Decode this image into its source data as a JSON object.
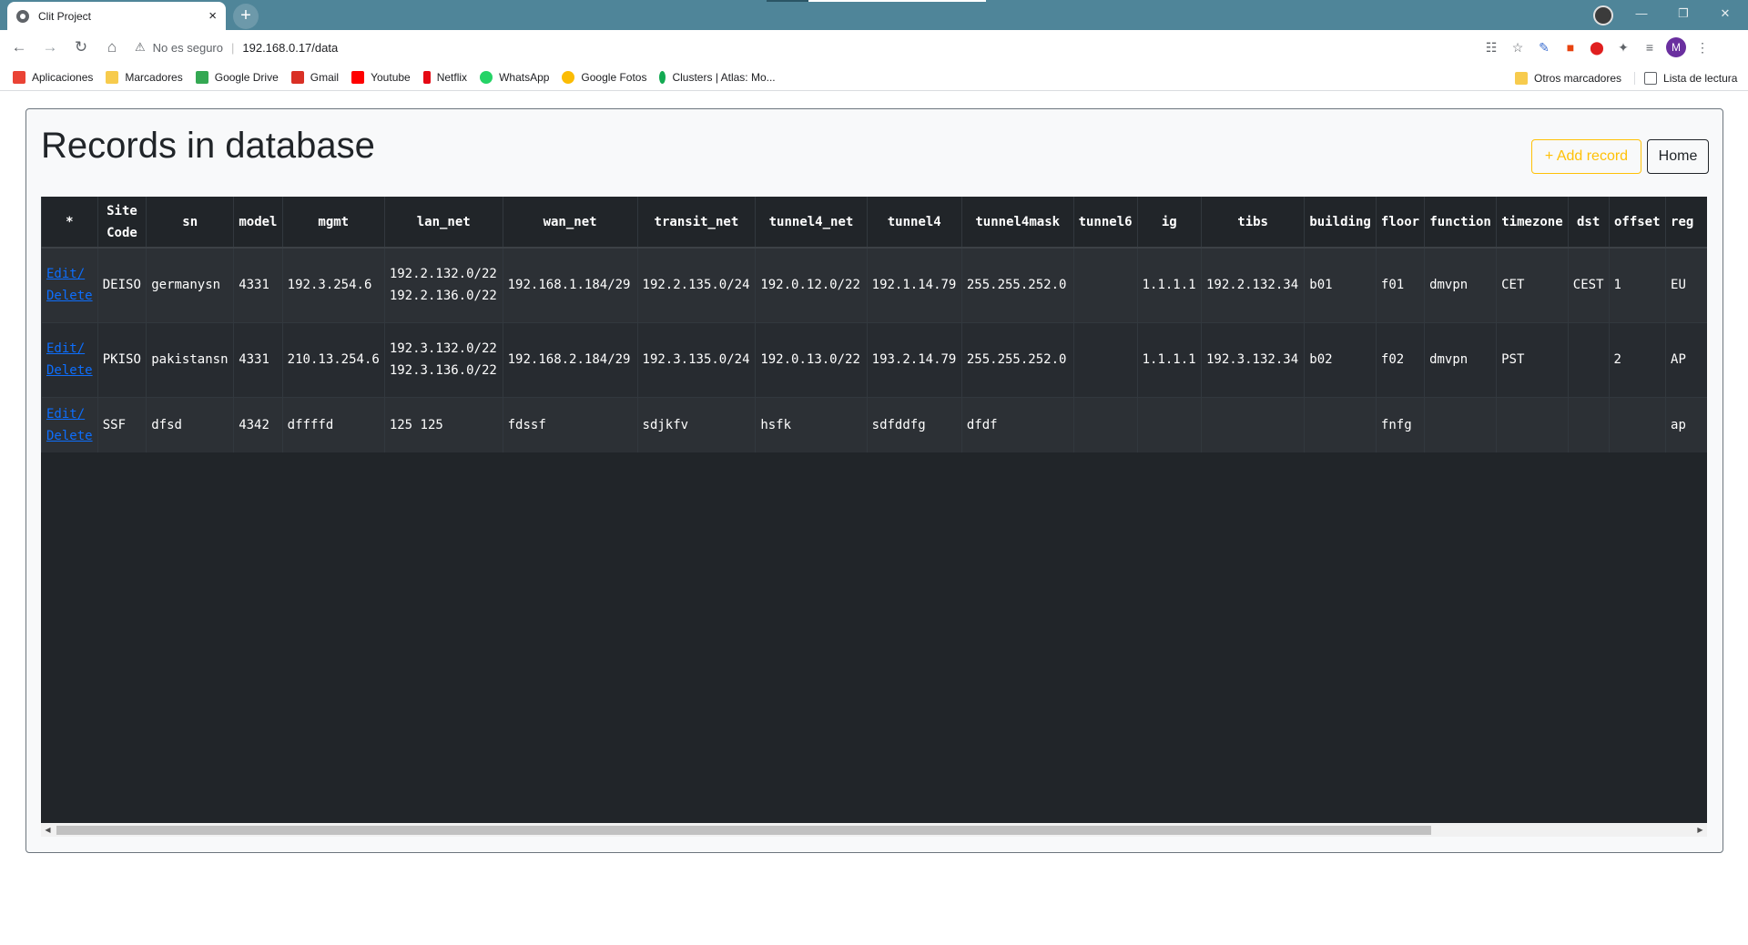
{
  "browser": {
    "tab_title": "Clit Project",
    "tab_close": "×",
    "new_tab": "+",
    "address_warning": "No es seguro",
    "url": "192.168.0.17/data",
    "bookmarks": [
      {
        "label": "Aplicaciones",
        "icon": "apps-grid-icon",
        "color": "#ea4335"
      },
      {
        "label": "Marcadores",
        "icon": "folder-icon",
        "color": "#f7cb4d"
      },
      {
        "label": "Google Drive",
        "icon": "google-drive-icon",
        "color": "#34a853"
      },
      {
        "label": "Gmail",
        "icon": "gmail-icon",
        "color": "#d93025"
      },
      {
        "label": "Youtube",
        "icon": "youtube-icon",
        "color": "#ff0000"
      },
      {
        "label": "Netflix",
        "icon": "netflix-icon",
        "color": "#e50914"
      },
      {
        "label": "WhatsApp",
        "icon": "whatsapp-icon",
        "color": "#25d366"
      },
      {
        "label": "Google Fotos",
        "icon": "google-photos-icon",
        "color": "#fbbc04"
      },
      {
        "label": "Clusters | Atlas: Mo...",
        "icon": "mongodb-leaf-icon",
        "color": "#13aa52"
      }
    ],
    "bookmarks_right": [
      {
        "label": "Otros marcadores",
        "icon": "folder-icon",
        "color": "#f7cb4d"
      },
      {
        "label": "Lista de lectura",
        "icon": "reading-list-icon",
        "color": "#5f6368"
      }
    ],
    "profile_initial": "M"
  },
  "page": {
    "title": "Records in database",
    "add_button": "+ Add record",
    "home_button": "Home"
  },
  "table": {
    "columns": [
      "*",
      "Site Code",
      "sn",
      "model",
      "mgmt",
      "lan_net",
      "wan_net",
      "transit_net",
      "tunnel4_net",
      "tunnel4",
      "tunnel4mask",
      "tunnel6",
      "ig",
      "tibs",
      "building",
      "floor",
      "function",
      "timezone",
      "dst",
      "offset",
      "reg"
    ],
    "action_edit": "Edit/",
    "action_delete": "Delete",
    "rows": [
      {
        "site_code": "DEISO",
        "sn": "germanysn",
        "model": "4331",
        "mgmt": "192.3.254.6",
        "lan_net": [
          "192.2.132.0/22",
          "192.2.136.0/22"
        ],
        "wan_net": "192.168.1.184/29",
        "transit_net": "192.2.135.0/24",
        "tunnel4_net": "192.0.12.0/22",
        "tunnel4": "192.1.14.79",
        "tunnel4mask": "255.255.252.0",
        "tunnel6": "",
        "ig": "1.1.1.1",
        "tibs": "192.2.132.34",
        "building": "b01",
        "floor": "f01",
        "function": "dmvpn",
        "timezone": "CET",
        "dst": "CEST",
        "offset": "1",
        "reg": "EU"
      },
      {
        "site_code": "PKISO",
        "sn": "pakistansn",
        "model": "4331",
        "mgmt": "210.13.254.6",
        "lan_net": [
          "192.3.132.0/22",
          "192.3.136.0/22"
        ],
        "wan_net": "192.168.2.184/29",
        "transit_net": "192.3.135.0/24",
        "tunnel4_net": "192.0.13.0/22",
        "tunnel4": "193.2.14.79",
        "tunnel4mask": "255.255.252.0",
        "tunnel6": "",
        "ig": "1.1.1.1",
        "tibs": "192.3.132.34",
        "building": "b02",
        "floor": "f02",
        "function": "dmvpn",
        "timezone": "PST",
        "dst": "",
        "offset": "2",
        "reg": "AP"
      },
      {
        "site_code": "SSF",
        "sn": "dfsd",
        "model": "4342",
        "mgmt": "dffffd",
        "lan_net": [
          "125 125"
        ],
        "wan_net": "fdssf",
        "transit_net": "sdjkfv",
        "tunnel4_net": "hsfk",
        "tunnel4": "sdfddfg",
        "tunnel4mask": "dfdf",
        "tunnel6": "",
        "ig": "",
        "tibs": "",
        "building": "",
        "floor": "fnfg",
        "function": "",
        "timezone": "",
        "dst": "",
        "offset": "",
        "reg": "ap"
      }
    ]
  }
}
